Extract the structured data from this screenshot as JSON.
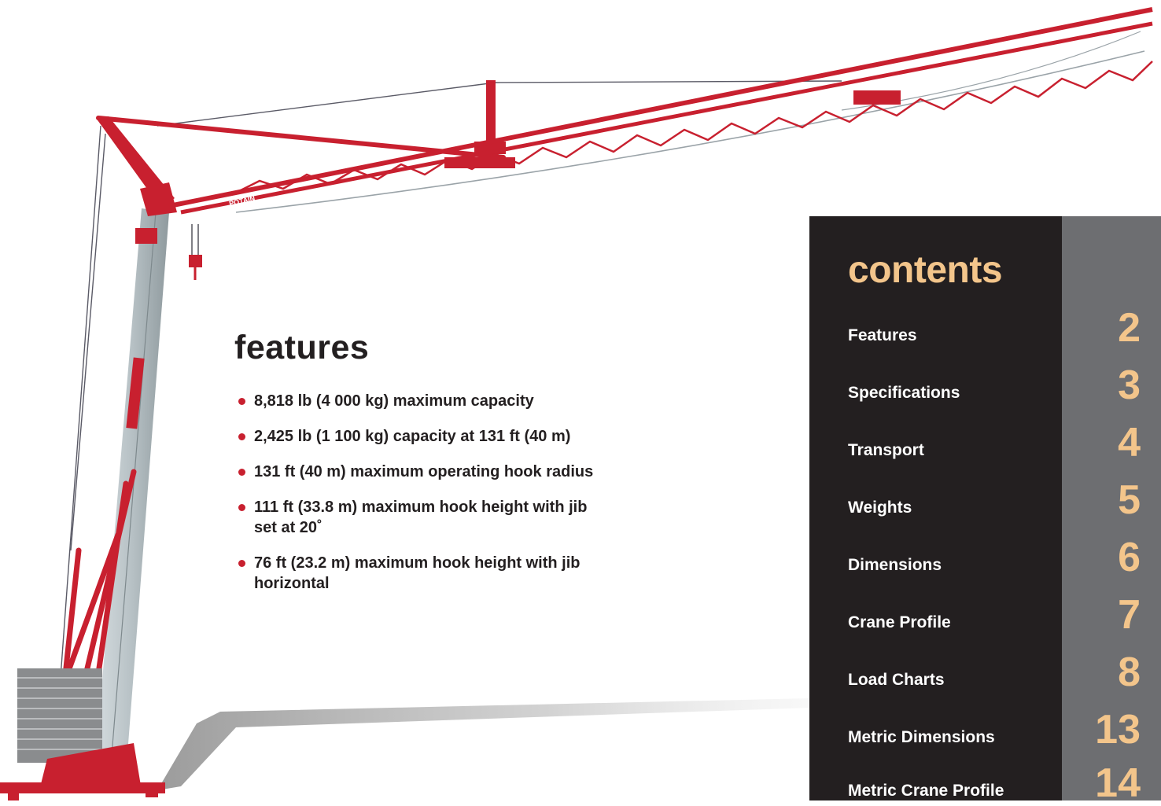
{
  "features": {
    "heading": "features",
    "items": [
      "8,818 lb (4 000 kg) maximum capacity",
      "2,425 lb (1 100 kg) capacity at 131 ft (40 m)",
      "131 ft (40 m) maximum operating hook radius",
      "111 ft (33.8 m) maximum hook height with jib set at 20˚",
      "76 ft (23.2 m) maximum hook height with jib horizontal"
    ]
  },
  "contents": {
    "heading": "contents",
    "entries": [
      {
        "label": "Features",
        "page": "2"
      },
      {
        "label": "Specifications",
        "page": "3"
      },
      {
        "label": "Transport",
        "page": "4"
      },
      {
        "label": "Weights",
        "page": "5"
      },
      {
        "label": "Dimensions",
        "page": "6"
      },
      {
        "label": "Crane Profile",
        "page": "7"
      },
      {
        "label": "Load Charts",
        "page": "8"
      },
      {
        "label": "Metric Dimensions",
        "page": "13"
      },
      {
        "label": "Metric Crane Profile",
        "page": "14"
      }
    ]
  },
  "crane_image": {
    "description_label": "POTAIN"
  },
  "colors": {
    "crane_red": "#c8202f",
    "mast_grey": "#b9c3c6",
    "panel_dark": "#231f20",
    "panel_grey": "#6d6e71",
    "accent_tan": "#f3c58b",
    "text_dark": "#231f20"
  }
}
